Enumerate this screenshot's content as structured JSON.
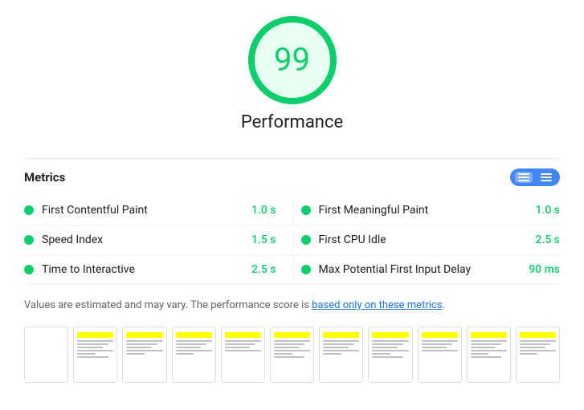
{
  "score": {
    "value": 99,
    "label": "Performance"
  },
  "metrics_section": {
    "title": "Metrics",
    "toggle": {
      "list_icon": "list-icon",
      "grid_icon": "grid-icon"
    },
    "items": [
      {
        "name": "First Contentful Paint",
        "value": "1.0 s",
        "color": "#0cce6b"
      },
      {
        "name": "First Meaningful Paint",
        "value": "1.0 s",
        "color": "#0cce6b"
      },
      {
        "name": "Speed Index",
        "value": "1.5 s",
        "color": "#0cce6b"
      },
      {
        "name": "First CPU Idle",
        "value": "2.5 s",
        "color": "#0cce6b"
      },
      {
        "name": "Time to Interactive",
        "value": "2.5 s",
        "color": "#0cce6b"
      },
      {
        "name": "Max Potential First Input Delay",
        "value": "90 ms",
        "color": "#0cce6b"
      }
    ]
  },
  "footnote": {
    "text_before": "Values are estimated and may vary. The performance score is ",
    "link_text": "based only on these metrics",
    "text_after": "."
  },
  "filmstrip": {
    "frames": [
      1,
      2,
      3,
      4,
      5,
      6,
      7,
      8,
      9,
      10,
      11
    ]
  }
}
